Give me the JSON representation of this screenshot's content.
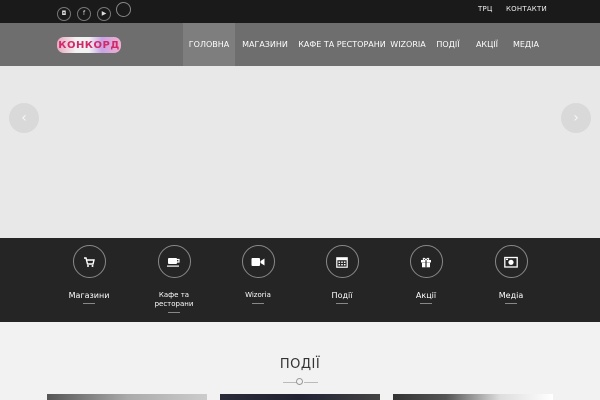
{
  "topbar": {
    "social": [
      {
        "icon": "instagram-icon",
        "glyph": "◘"
      },
      {
        "icon": "facebook-icon",
        "glyph": "f"
      },
      {
        "icon": "youtube-icon",
        "glyph": "▶"
      }
    ],
    "links": [
      "ТРЦ",
      "КОНТАКТИ"
    ]
  },
  "navbar": {
    "logo_text": "КОНКОРД",
    "items": [
      "ГОЛОВНА",
      "МАГАЗИНИ",
      "КАФЕ ТА РЕСТОРАНИ",
      "WIZORIA",
      "ПОДІЇ",
      "АКЦІЇ",
      "МЕДІА"
    ],
    "active_index": 0
  },
  "hero": {
    "prev_glyph": "‹",
    "next_glyph": "›"
  },
  "categories": [
    {
      "label": "Магазини",
      "icon": "cart-icon"
    },
    {
      "label": "Кафе та ресторани",
      "icon": "coffee-cup-icon"
    },
    {
      "label": "Wizoria",
      "icon": "video-camera-icon"
    },
    {
      "label": "Події",
      "icon": "calendar-icon"
    },
    {
      "label": "Акції",
      "icon": "gift-icon"
    },
    {
      "label": "Медіа",
      "icon": "photo-icon"
    }
  ],
  "events": {
    "title": "ПОДІЇ"
  },
  "colors": {
    "topbar": "#1a1a1a",
    "navbar": "#6e6e6e",
    "nav_active": "#7e7e7e",
    "hero": "#e8e8e8",
    "band": "#252525",
    "page_bg": "#f2f2f2"
  }
}
